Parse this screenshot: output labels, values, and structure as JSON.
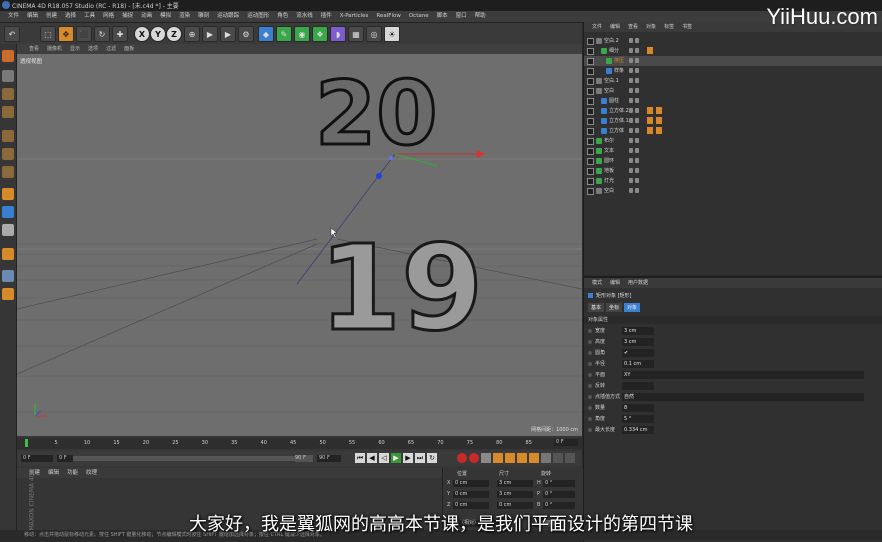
{
  "window": {
    "title": "CINEMA 4D R18.057 Studio (RC - R18) - [未.c4d *] - 主要"
  },
  "watermark": "YiiHuu.com",
  "menubar": {
    "items": [
      "文件",
      "编辑",
      "创建",
      "选择",
      "工具",
      "网格",
      "捕捉",
      "动画",
      "模拟",
      "渲染",
      "雕刻",
      "运动跟踪",
      "运动图形",
      "角色",
      "流水线",
      "插件",
      "X-Particles",
      "RealFlow",
      "Octane",
      "脚本",
      "窗口",
      "帮助"
    ]
  },
  "viewport": {
    "menu": [
      "查看",
      "摄像机",
      "显示",
      "选项",
      "过滤",
      "面板"
    ],
    "label": "透视视图",
    "info": "网格间距：1000 cm",
    "scene_text_top": "20",
    "scene_text_bottom": "19"
  },
  "timeline": {
    "ticks": [
      "0",
      "5",
      "10",
      "15",
      "20",
      "25",
      "30",
      "35",
      "40",
      "45",
      "50",
      "55",
      "60",
      "65",
      "70",
      "75",
      "80",
      "85",
      "90"
    ],
    "frame_end_label": "0 F",
    "current_frame": "0 F",
    "start_field": "0 F",
    "end_field": "90 F",
    "end_field_right": "90 F"
  },
  "material_panel": {
    "menu": [
      "创建",
      "编辑",
      "功能",
      "纹理"
    ]
  },
  "coord_panel": {
    "headers": [
      "位置",
      "尺寸",
      "旋转"
    ],
    "rows": [
      {
        "axis": "X",
        "pos": "0 cm",
        "size": "3 cm",
        "rot_axis": "H",
        "rot": "0 °"
      },
      {
        "axis": "Y",
        "pos": "0 cm",
        "size": "3 cm",
        "rot_axis": "P",
        "rot": "0 °"
      },
      {
        "axis": "Z",
        "pos": "0 cm",
        "size": "0 cm",
        "rot_axis": "B",
        "rot": "0 °"
      }
    ],
    "mode": "对象（相对）",
    "apply": "应用"
  },
  "object_panel": {
    "menu": [
      "文件",
      "编辑",
      "查看",
      "对象",
      "标签",
      "书签"
    ],
    "objects": [
      {
        "indent": 0,
        "name": "空白.2",
        "icon": "null",
        "tags": 0
      },
      {
        "indent": 1,
        "name": "细分",
        "icon": "green",
        "tags": 1
      },
      {
        "indent": 2,
        "name": "挤压",
        "icon": "green",
        "tags": 0,
        "selected": true
      },
      {
        "indent": 2,
        "name": "样条",
        "icon": "blue",
        "tags": 0
      },
      {
        "indent": 0,
        "name": "空白.1",
        "icon": "null",
        "tags": 0
      },
      {
        "indent": 0,
        "name": "空白",
        "icon": "null",
        "tags": 0
      },
      {
        "indent": 1,
        "name": "圆柱",
        "icon": "blue",
        "tags": 0
      },
      {
        "indent": 1,
        "name": "立方体.2",
        "icon": "blue",
        "tags": 2
      },
      {
        "indent": 1,
        "name": "立方体.1",
        "icon": "blue",
        "tags": 2
      },
      {
        "indent": 1,
        "name": "立方体",
        "icon": "blue",
        "tags": 2
      },
      {
        "indent": 0,
        "name": "布尔",
        "icon": "green",
        "tags": 0
      },
      {
        "indent": 0,
        "name": "文本",
        "icon": "green",
        "tags": 0
      },
      {
        "indent": 0,
        "name": "圆环",
        "icon": "green",
        "tags": 0
      },
      {
        "indent": 0,
        "name": "地板",
        "icon": "green",
        "tags": 0
      },
      {
        "indent": 0,
        "name": "灯光",
        "icon": "green",
        "tags": 0
      },
      {
        "indent": 0,
        "name": "空白",
        "icon": "null",
        "tags": 0
      }
    ]
  },
  "attr_panel": {
    "menu": [
      "模式",
      "编辑",
      "用户数据"
    ],
    "object_title": "矩形对象 [矩形]",
    "tabs": [
      "基本",
      "坐标",
      "对象"
    ],
    "section": "对象属性",
    "rows": [
      {
        "label": "宽度",
        "value": "3 cm"
      },
      {
        "label": "高度",
        "value": "3 cm"
      },
      {
        "label": "圆角",
        "value": "✔"
      },
      {
        "label": "半径",
        "value": "0.1 cm"
      },
      {
        "label": "平面",
        "value": "XY"
      },
      {
        "label": "反转",
        "value": ""
      },
      {
        "label": "点插值方式",
        "value": "自然"
      },
      {
        "label": "数量",
        "value": "8"
      },
      {
        "label": "角度",
        "value": "5 °"
      },
      {
        "label": "最大长度",
        "value": "0.334 cm"
      }
    ]
  },
  "status": "移动：点击并拖动鼠标移动元素。按住 SHIFT 键量化移动；节点编辑模式时按住 SHIFT 键增加选择对象；按住 CTRL 键减少选择对象。",
  "subtitle": "大家好，我是翼狐网的高高本节课，是我们平面设计的第四节课",
  "colors": {
    "accent": "#d78a2a",
    "axis_x": "#e03030",
    "axis_y": "#40c040",
    "axis_z": "#3050e0",
    "selected": "#d78a2a"
  }
}
